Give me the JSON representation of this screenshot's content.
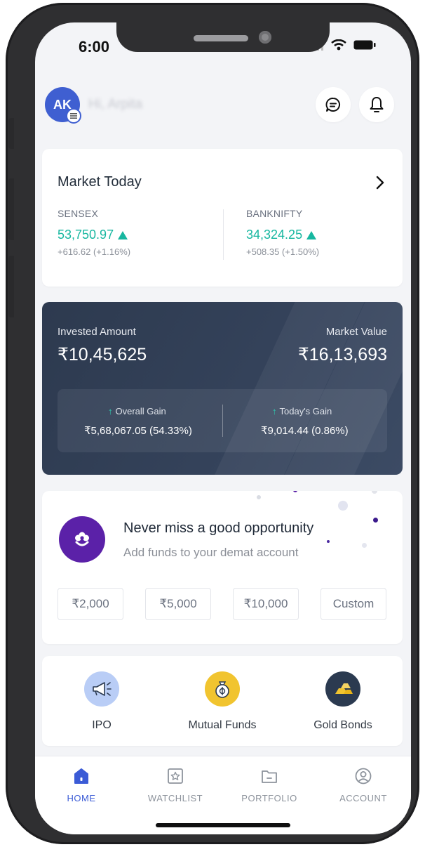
{
  "status_bar": {
    "time": "6:00"
  },
  "header": {
    "avatar_initials": "AK",
    "greeting": "Hi, Arpita"
  },
  "market_today": {
    "title": "Market Today",
    "indices": [
      {
        "name": "SENSEX",
        "value": "53,750.97",
        "change": "+616.62 (+1.16%)"
      },
      {
        "name": "BANKNIFTY",
        "value": "34,324.25",
        "change": "+508.35 (+1.50%)"
      }
    ]
  },
  "portfolio": {
    "invested_label": "Invested Amount",
    "invested_value": "₹10,45,625",
    "market_label": "Market Value",
    "market_value": "₹16,13,693",
    "overall_gain_label": "Overall Gain",
    "overall_gain_value": "₹5,68,067.05 (54.33%)",
    "todays_gain_label": "Today's Gain",
    "todays_gain_value": "₹9,014.44 (0.86%)"
  },
  "opportunity": {
    "title": "Never miss a good opportunity",
    "subtitle": "Add funds to your demat account",
    "amounts": [
      "₹2,000",
      "₹5,000",
      "₹10,000",
      "Custom"
    ]
  },
  "quick_links": [
    {
      "label": "IPO",
      "icon": "megaphone-icon",
      "color": "#b9cdf6"
    },
    {
      "label": "Mutual Funds",
      "icon": "money-bag-icon",
      "color": "#f1c42f"
    },
    {
      "label": "Gold Bonds",
      "icon": "gold-bars-icon",
      "color": "#2b3a50"
    }
  ],
  "tabs": [
    {
      "label": "HOME",
      "icon": "home-icon",
      "active": true
    },
    {
      "label": "WATCHLIST",
      "icon": "star-box-icon",
      "active": false
    },
    {
      "label": "PORTFOLIO",
      "icon": "folder-icon",
      "active": false
    },
    {
      "label": "ACCOUNT",
      "icon": "user-circle-icon",
      "active": false
    }
  ],
  "colors": {
    "accent": "#3b5bd6",
    "positive": "#17b7a0",
    "purple": "#5b21a8",
    "card_dark": "#2d3a4f"
  }
}
